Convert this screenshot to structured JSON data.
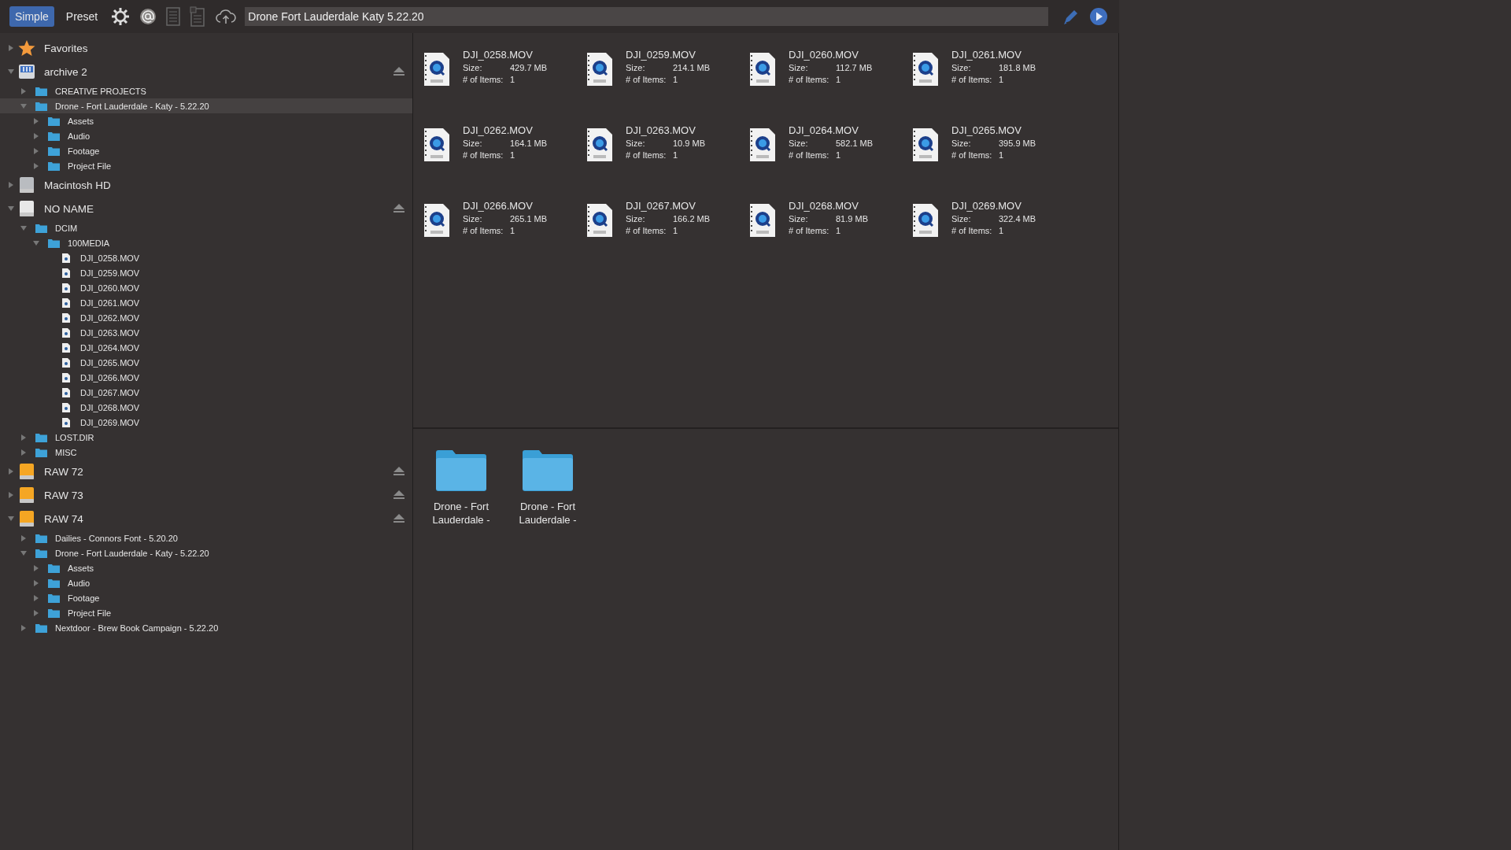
{
  "toolbar": {
    "modes": [
      {
        "label": "Simple",
        "selected": true
      },
      {
        "label": "Preset",
        "selected": false
      }
    ],
    "path": "Drone Fort Lauderdale Katy 5.22.20"
  },
  "sidebar": {
    "items": [
      {
        "kind": "favorites",
        "label": "Favorites",
        "expanded": false,
        "ejectable": false,
        "selected": false
      },
      {
        "kind": "server",
        "label": "archive 2",
        "expanded": true,
        "ejectable": true,
        "selected": false,
        "children": [
          {
            "kind": "folder",
            "label": "CREATIVE PROJECTS",
            "expanded": false,
            "selected": false
          },
          {
            "kind": "folder",
            "label": "Drone - Fort Lauderdale - Katy - 5.22.20",
            "expanded": true,
            "selected": true,
            "children": [
              {
                "kind": "folder",
                "label": "Assets",
                "expanded": false,
                "selected": false
              },
              {
                "kind": "folder",
                "label": "Audio",
                "expanded": false,
                "selected": false
              },
              {
                "kind": "folder",
                "label": "Footage",
                "expanded": false,
                "selected": false
              },
              {
                "kind": "folder",
                "label": "Project File",
                "expanded": false,
                "selected": false
              }
            ]
          }
        ]
      },
      {
        "kind": "disk",
        "label": "Macintosh HD",
        "expanded": false,
        "ejectable": false,
        "selected": false
      },
      {
        "kind": "removable",
        "label": "NO NAME",
        "expanded": true,
        "ejectable": true,
        "selected": false,
        "children": [
          {
            "kind": "folder",
            "label": "DCIM",
            "expanded": true,
            "selected": false,
            "children": [
              {
                "kind": "folder",
                "label": "100MEDIA",
                "expanded": true,
                "selected": false,
                "children": [
                  {
                    "kind": "file",
                    "label": "DJI_0258.MOV",
                    "selected": false
                  },
                  {
                    "kind": "file",
                    "label": "DJI_0259.MOV",
                    "selected": false
                  },
                  {
                    "kind": "file",
                    "label": "DJI_0260.MOV",
                    "selected": false
                  },
                  {
                    "kind": "file",
                    "label": "DJI_0261.MOV",
                    "selected": false
                  },
                  {
                    "kind": "file",
                    "label": "DJI_0262.MOV",
                    "selected": false
                  },
                  {
                    "kind": "file",
                    "label": "DJI_0263.MOV",
                    "selected": false
                  },
                  {
                    "kind": "file",
                    "label": "DJI_0264.MOV",
                    "selected": false
                  },
                  {
                    "kind": "file",
                    "label": "DJI_0265.MOV",
                    "selected": false
                  },
                  {
                    "kind": "file",
                    "label": "DJI_0266.MOV",
                    "selected": false
                  },
                  {
                    "kind": "file",
                    "label": "DJI_0267.MOV",
                    "selected": false
                  },
                  {
                    "kind": "file",
                    "label": "DJI_0268.MOV",
                    "selected": false
                  },
                  {
                    "kind": "file",
                    "label": "DJI_0269.MOV",
                    "selected": false
                  }
                ]
              }
            ]
          },
          {
            "kind": "folder",
            "label": "LOST.DIR",
            "expanded": false,
            "selected": false
          },
          {
            "kind": "folder",
            "label": "MISC",
            "expanded": false,
            "selected": false
          }
        ]
      },
      {
        "kind": "external",
        "label": "RAW 72",
        "expanded": false,
        "ejectable": true,
        "selected": false
      },
      {
        "kind": "external",
        "label": "RAW 73",
        "expanded": false,
        "ejectable": true,
        "selected": false
      },
      {
        "kind": "external",
        "label": "RAW 74",
        "expanded": true,
        "ejectable": true,
        "selected": false,
        "children": [
          {
            "kind": "folder",
            "label": "Dailies - Connors Font - 5.20.20",
            "expanded": false,
            "selected": false
          },
          {
            "kind": "folder",
            "label": "Drone - Fort Lauderdale - Katy - 5.22.20",
            "expanded": true,
            "selected": false,
            "children": [
              {
                "kind": "folder",
                "label": "Assets",
                "expanded": false,
                "selected": false
              },
              {
                "kind": "folder",
                "label": "Audio",
                "expanded": false,
                "selected": false
              },
              {
                "kind": "folder",
                "label": "Footage",
                "expanded": false,
                "selected": false
              },
              {
                "kind": "folder",
                "label": "Project File",
                "expanded": false,
                "selected": false
              }
            ]
          },
          {
            "kind": "folder",
            "label": "Nextdoor - Brew Book Campaign - 5.22.20",
            "expanded": false,
            "selected": false
          }
        ]
      }
    ]
  },
  "files": [
    {
      "name": "DJI_0258.MOV",
      "size_label": "Size:",
      "size": "429.7 MB",
      "items_label": "# of Items:",
      "items": "1"
    },
    {
      "name": "DJI_0259.MOV",
      "size_label": "Size:",
      "size": "214.1 MB",
      "items_label": "# of Items:",
      "items": "1"
    },
    {
      "name": "DJI_0260.MOV",
      "size_label": "Size:",
      "size": "112.7 MB",
      "items_label": "# of Items:",
      "items": "1"
    },
    {
      "name": "DJI_0261.MOV",
      "size_label": "Size:",
      "size": "181.8 MB",
      "items_label": "# of Items:",
      "items": "1"
    },
    {
      "name": "DJI_0262.MOV",
      "size_label": "Size:",
      "size": "164.1 MB",
      "items_label": "# of Items:",
      "items": "1"
    },
    {
      "name": "DJI_0263.MOV",
      "size_label": "Size:",
      "size": "10.9 MB",
      "items_label": "# of Items:",
      "items": "1"
    },
    {
      "name": "DJI_0264.MOV",
      "size_label": "Size:",
      "size": "582.1 MB",
      "items_label": "# of Items:",
      "items": "1"
    },
    {
      "name": "DJI_0265.MOV",
      "size_label": "Size:",
      "size": "395.9 MB",
      "items_label": "# of Items:",
      "items": "1"
    },
    {
      "name": "DJI_0266.MOV",
      "size_label": "Size:",
      "size": "265.1 MB",
      "items_label": "# of Items:",
      "items": "1"
    },
    {
      "name": "DJI_0267.MOV",
      "size_label": "Size:",
      "size": "166.2 MB",
      "items_label": "# of Items:",
      "items": "1"
    },
    {
      "name": "DJI_0268.MOV",
      "size_label": "Size:",
      "size": "81.9 MB",
      "items_label": "# of Items:",
      "items": "1"
    },
    {
      "name": "DJI_0269.MOV",
      "size_label": "Size:",
      "size": "322.4 MB",
      "items_label": "# of Items:",
      "items": "1"
    }
  ],
  "folders": [
    {
      "label": "Drone - Fort Lauderdale -"
    },
    {
      "label": "Drone - Fort Lauderdale -"
    }
  ]
}
